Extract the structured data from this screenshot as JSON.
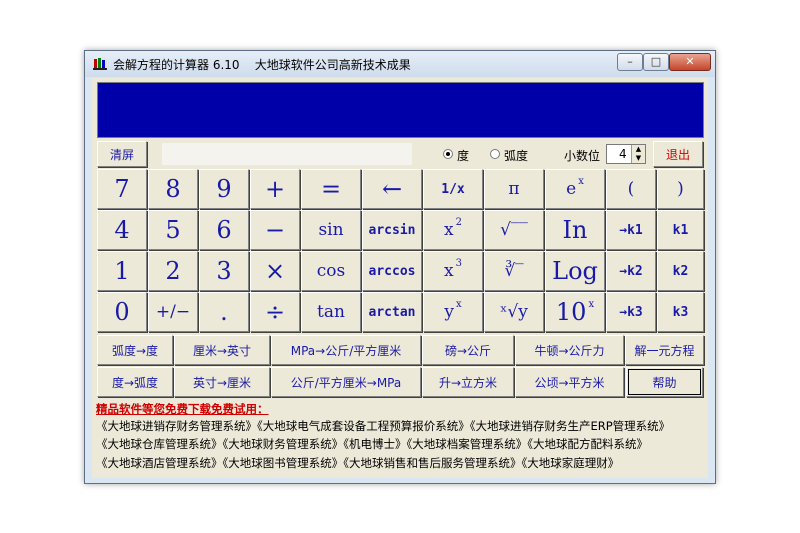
{
  "window": {
    "title": "会解方程的计算器 6.10    大地球软件公司高新技术成果",
    "min": "–",
    "max": "□",
    "close": "✕"
  },
  "controls": {
    "clear": "清屏",
    "deg": "度",
    "rad": "弧度",
    "decimal_label": "小数位",
    "decimal_value": "4",
    "exit": "退出"
  },
  "keys": {
    "r1": [
      "7",
      "8",
      "9",
      "+",
      "=",
      "←",
      "1/x",
      "π",
      "e",
      "(",
      ")"
    ],
    "r2": [
      "4",
      "5",
      "6",
      "−",
      "sin",
      "arcsin",
      "x",
      "√‾‾",
      "In",
      "→k1",
      "k1"
    ],
    "r3": [
      "1",
      "2",
      "3",
      "×",
      "cos",
      "arccos",
      "x",
      "∛‾",
      "Log",
      "→k2",
      "k2"
    ],
    "r4": [
      "0",
      "+/−",
      ".",
      "÷",
      "tan",
      "arctan",
      "y",
      "ˣ√y",
      "10",
      "→k3",
      "k3"
    ],
    "sup_x": "x",
    "sup_2": "2",
    "sup_3": "3"
  },
  "converters": {
    "row1": [
      "弧度→度",
      "厘米→英寸",
      "MPa→公斤/平方厘米",
      "磅→公斤",
      "牛顿→公斤力",
      "解一元方程"
    ],
    "row2": [
      "度→弧度",
      "英寸→厘米",
      "公斤/平方厘米→MPa",
      "升→立方米",
      "公顷→平方米",
      "帮助"
    ]
  },
  "ads": {
    "header": "精品软件等您免费下载免费试用：",
    "line1": "《大地球进销存财务管理系统》《大地球电气成套设备工程预算报价系统》《大地球进销存财务生产ERP管理系统》",
    "line2": "《大地球仓库管理系统》《大地球财务管理系统》《机电博士》《大地球档案管理系统》《大地球配方配料系统》",
    "line3": "《大地球酒店管理系统》《大地球图书管理系统》《大地球销售和售后服务管理系统》《大地球家庭理财》"
  },
  "colors": {
    "display": "#0000a8",
    "key_text": "#1a1aa8",
    "exit_text": "#d00000",
    "ad_header": "#d00000"
  }
}
